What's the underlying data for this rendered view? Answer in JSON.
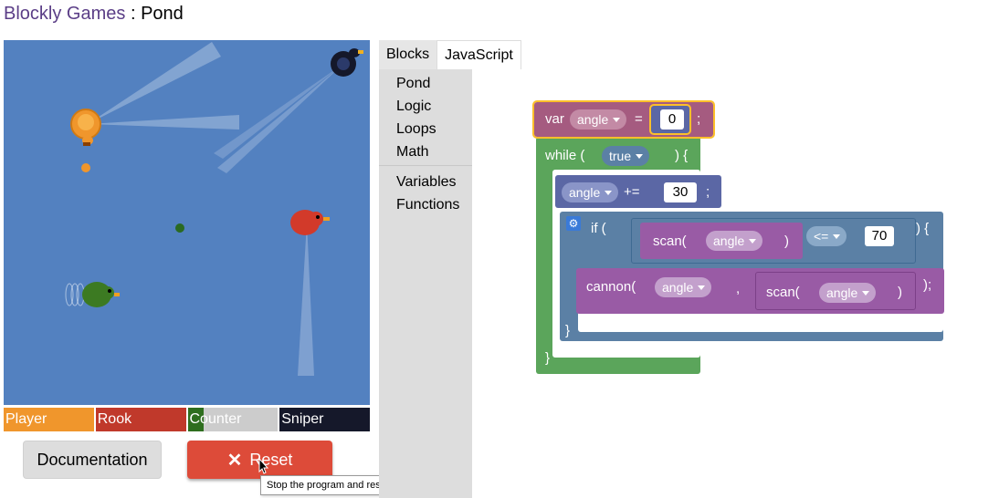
{
  "header": {
    "app_name": "Blockly Games",
    "separator": ":",
    "level_name": "Pond"
  },
  "avatars": [
    {
      "name": "Player",
      "color": "#f0962c",
      "health": 1.0
    },
    {
      "name": "Rook",
      "color": "#c0392b",
      "health": 1.0
    },
    {
      "name": "Counter",
      "color": "#2e6e1e",
      "health": 0.18
    },
    {
      "name": "Sniper",
      "color": "#15182a",
      "health": 1.0
    }
  ],
  "buttons": {
    "documentation": "Documentation",
    "reset": "Reset",
    "reset_icon": "close-x-icon"
  },
  "tooltip": "Stop the program and reset the level.",
  "editor": {
    "tabs": [
      "Blocks",
      "JavaScript"
    ],
    "active_tab": "Blocks",
    "categories": [
      "Pond",
      "Logic",
      "Loops",
      "Math",
      "Variables",
      "Functions"
    ]
  },
  "blocks": {
    "var_keyword": "var",
    "var_name": "angle",
    "assign_op": "=",
    "init_value": "0",
    "semicolon": ";",
    "while_open": "while (",
    "while_cond": "true",
    "while_close": ") {",
    "increment_var": "angle",
    "increment_op": "+=",
    "increment_value": "30",
    "if_open": "if (",
    "scan_fn": "scan(",
    "scan_arg": "angle",
    "close_paren": ")",
    "compare_op": "<=",
    "compare_value": "70",
    "if_close": ") {",
    "cannon_fn": "cannon(",
    "cannon_arg": "angle",
    "comma": ",",
    "scan_fn2": "scan(",
    "scan_arg2": "angle",
    "close_paren2": ")",
    "call_end": ");",
    "brace_if": "}",
    "brace_while": "}"
  },
  "colors": {
    "pond": "#5381c0",
    "variables_block": "#a55b80",
    "loop_block": "#5ba55b",
    "logic_block": "#5b80a5",
    "procedure_block": "#995ba5",
    "reset_button": "#dd4b39"
  }
}
